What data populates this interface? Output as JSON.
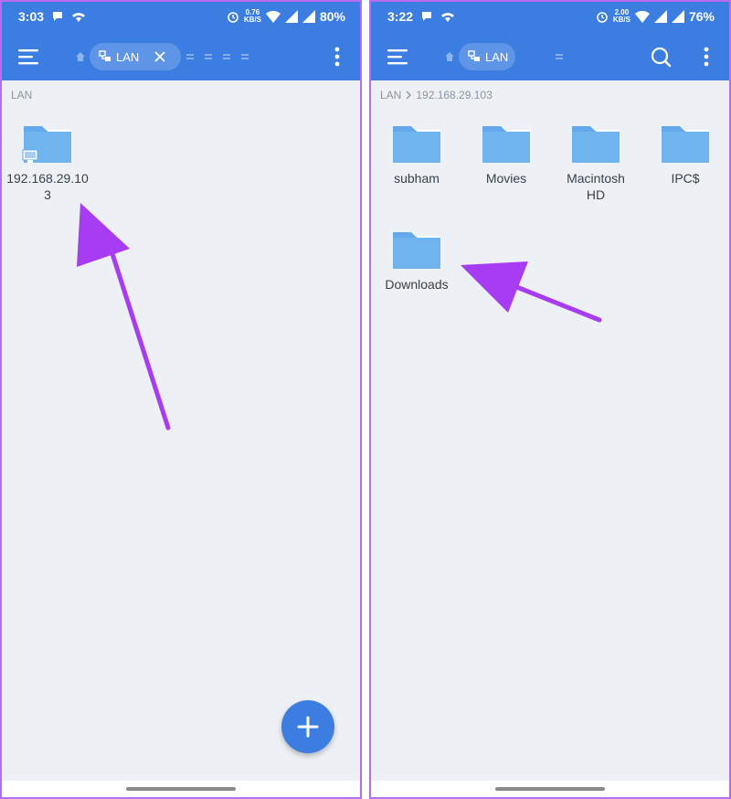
{
  "left": {
    "status": {
      "time": "3:03",
      "speed_value": "0.76",
      "speed_unit": "KB/S",
      "battery": "80%"
    },
    "toolbar": {
      "tab_label": "LAN"
    },
    "breadcrumb": [
      "LAN"
    ],
    "items": [
      {
        "label": "192.168.29.103",
        "icon": "network-folder-icon"
      }
    ],
    "fab_icon": "plus-icon"
  },
  "right": {
    "status": {
      "time": "3:22",
      "speed_value": "2.00",
      "speed_unit": "KB/S",
      "battery": "76%"
    },
    "toolbar": {
      "tab_label": "LAN"
    },
    "breadcrumb": [
      "LAN",
      "192.168.29.103"
    ],
    "items": [
      {
        "label": "subham",
        "icon": "folder-icon"
      },
      {
        "label": "Movies",
        "icon": "folder-icon"
      },
      {
        "label": "Macintosh HD",
        "icon": "folder-icon"
      },
      {
        "label": "IPC$",
        "icon": "folder-icon"
      },
      {
        "label": "Downloads",
        "icon": "folder-icon"
      }
    ]
  },
  "colors": {
    "primary": "#3b7de0",
    "folder": "#62a8ea",
    "arrow": "#a83cf2",
    "background": "#edf0f5"
  }
}
